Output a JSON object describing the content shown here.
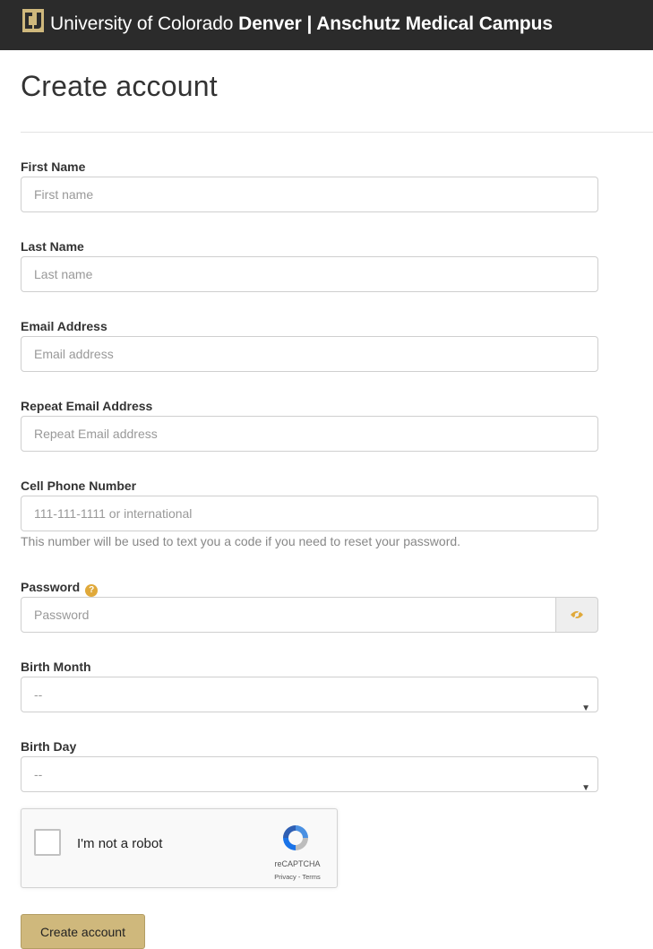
{
  "header": {
    "logo_icon": "cu-logo-icon",
    "brand_prefix": "University of Colorado ",
    "brand_bold": "Denver | Anschutz Medical Campus"
  },
  "page": {
    "title": "Create account"
  },
  "form": {
    "first_name": {
      "label": "First Name",
      "placeholder": "First name"
    },
    "last_name": {
      "label": "Last Name",
      "placeholder": "Last name"
    },
    "email": {
      "label": "Email Address",
      "placeholder": "Email address"
    },
    "repeat_email": {
      "label": "Repeat Email Address",
      "placeholder": "Repeat Email address"
    },
    "phone": {
      "label": "Cell Phone Number",
      "placeholder": "111-111-1111 or international",
      "help": "This number will be used to text you a code if you need to reset your password."
    },
    "password": {
      "label": "Password",
      "placeholder": "Password",
      "help_icon": "question-icon",
      "toggle_icon": "eye-slash-icon"
    },
    "birth_month": {
      "label": "Birth Month",
      "selected": "--"
    },
    "birth_day": {
      "label": "Birth Day",
      "selected": "--"
    },
    "recaptcha": {
      "checkbox_label": "I'm not a robot",
      "brand": "reCAPTCHA",
      "links": "Privacy - Terms"
    },
    "submit_label": "Create account"
  },
  "colors": {
    "topbar": "#2b2b2b",
    "accent_gold": "#cfb87c",
    "help_icon": "#e0a93a"
  }
}
